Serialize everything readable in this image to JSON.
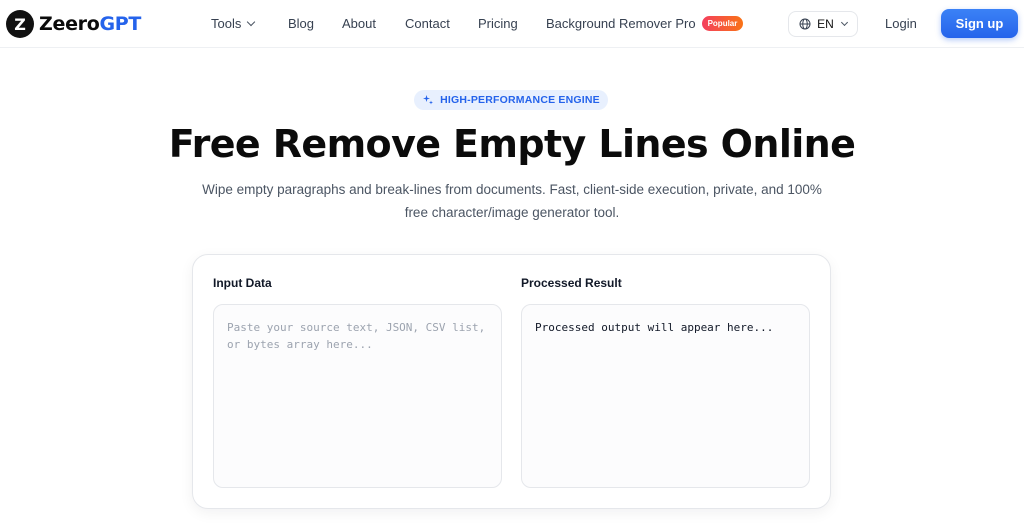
{
  "brand": {
    "name_prefix": "Zeero",
    "name_suffix": "GPT",
    "logo_letter": "Z"
  },
  "nav": {
    "tools": "Tools",
    "blog": "Blog",
    "about": "About",
    "contact": "Contact",
    "pricing": "Pricing",
    "bg_remover": "Background Remover Pro",
    "popular_badge": "Popular"
  },
  "header": {
    "language": "EN",
    "login": "Login",
    "signup": "Sign up"
  },
  "hero": {
    "pill": "HIGH-PERFORMANCE ENGINE",
    "title": "Free Remove Empty Lines Online",
    "subtitle": "Wipe empty paragraphs and break-lines from documents. Fast, client-side execution, private, and 100% free character/image generator tool."
  },
  "tool": {
    "input_label": "Input Data",
    "input_placeholder": "Paste your source text, JSON, CSV list, or bytes array here...",
    "input_value": "",
    "output_label": "Processed Result",
    "output_text": "Processed output will appear here..."
  },
  "colors": {
    "accent": "#2563eb",
    "popular": "#f43f5e",
    "pill_bg": "#e8f0fe"
  },
  "icons": {
    "lang": "globe-icon",
    "pill": "sparkle-icon",
    "dropdown": "chevron-down-icon"
  }
}
